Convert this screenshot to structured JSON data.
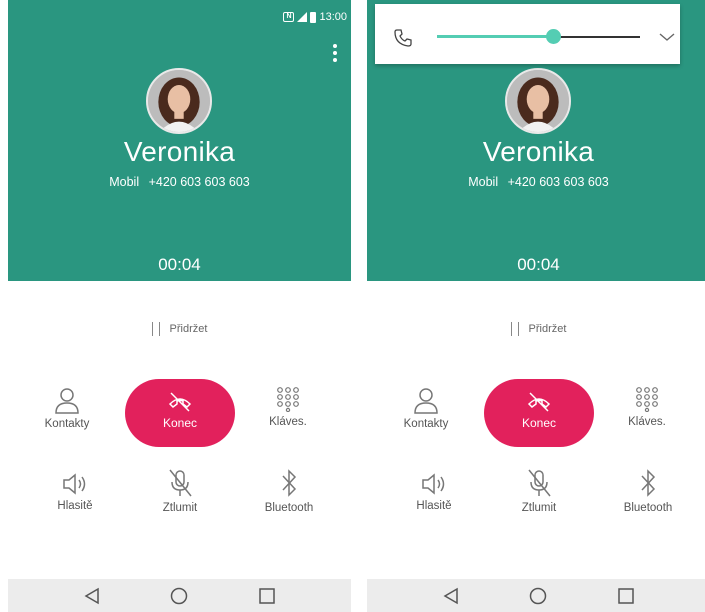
{
  "status_bar": {
    "time": "13:00"
  },
  "call": {
    "name": "Veronika",
    "number_type": "Mobil",
    "number": "+420 603 603 603",
    "duration": "00:04"
  },
  "hold": {
    "label": "Přidržet"
  },
  "buttons": {
    "contacts": "Kontakty",
    "end": "Konec",
    "keypad": "Kláves.",
    "speaker": "Hlasitě",
    "mute": "Ztlumit",
    "bluetooth": "Bluetooth"
  },
  "volume": {
    "level": 0.57
  },
  "colors": {
    "header_bg": "#2a9680",
    "end_call": "#e2215c",
    "slider_accent": "#54cdb3"
  },
  "icons": [
    "nfc-icon",
    "signal-icon",
    "battery-icon",
    "menu-icon",
    "contacts-icon",
    "end-call-icon",
    "keypad-icon",
    "speaker-icon",
    "mute-icon",
    "bluetooth-icon",
    "back-icon",
    "home-icon",
    "recents-icon",
    "phone-icon",
    "chevron-down-icon"
  ]
}
